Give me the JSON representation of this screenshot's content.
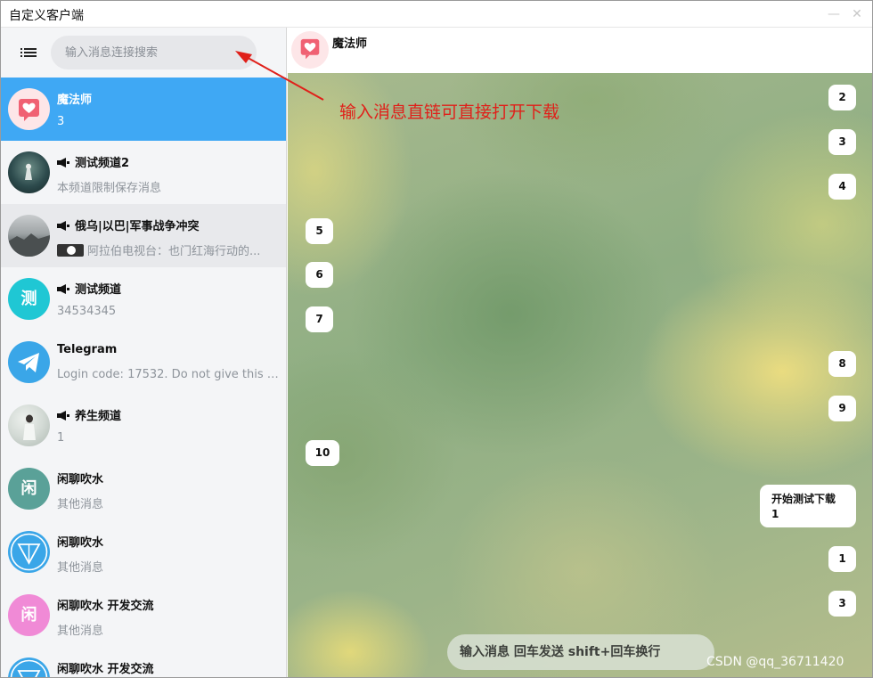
{
  "window": {
    "title": "自定义客户端",
    "minimize_icon": "minimize-icon",
    "close_icon": "close-icon"
  },
  "sidebar": {
    "menu_icon": "menu-list-icon",
    "search_placeholder": "输入消息连接搜索",
    "chats": [
      {
        "name": "魔法师",
        "preview": "3",
        "avatar": "heart-chat-avatar",
        "channel": false,
        "active": true
      },
      {
        "name": "测试频道2",
        "preview": "本频道限制保存消息",
        "avatar": "photo-avatar",
        "channel": true
      },
      {
        "name": "俄乌|以巴|军事战争冲突",
        "preview": "阿拉伯电视台：也门红海行动的...",
        "avatar": "photo-avatar",
        "channel": true,
        "preview_media": "video-thumbnail"
      },
      {
        "name": "测试频道",
        "preview": "34534345",
        "avatar_letter": "测",
        "avatar_color": "#1fc7d4",
        "channel": true
      },
      {
        "name": "Telegram",
        "preview": "Login code: 17532. Do not give this co...",
        "avatar": "telegram-logo",
        "avatar_color": "#3aa6e8",
        "channel": false
      },
      {
        "name": "养生频道",
        "preview": "1",
        "avatar": "photo-avatar",
        "channel": true
      },
      {
        "name": "闲聊吹水",
        "preview": "其他消息",
        "avatar_letter": "闲",
        "avatar_color": "#5aa198",
        "channel": false
      },
      {
        "name": "闲聊吹水",
        "preview": "其他消息",
        "avatar": "triangle-logo",
        "avatar_color": "#3aa6e8",
        "channel": false
      },
      {
        "name": "闲聊吹水 开发交流",
        "preview": "其他消息",
        "avatar_letter": "闲",
        "avatar_color": "#f08ad6",
        "channel": false
      },
      {
        "name": "闲聊吹水 开发交流",
        "preview": "",
        "avatar": "triangle-logo",
        "avatar_color": "#3aa6e8",
        "channel": false
      }
    ]
  },
  "chat": {
    "title": "魔法师",
    "avatar": "heart-chat-avatar",
    "messages": [
      {
        "text": "2",
        "side": "right"
      },
      {
        "text": "3",
        "side": "right"
      },
      {
        "text": "4",
        "side": "right"
      },
      {
        "text": "5",
        "side": "left"
      },
      {
        "text": "6",
        "side": "left"
      },
      {
        "text": "7",
        "side": "left"
      },
      {
        "text": "8",
        "side": "right"
      },
      {
        "text": "9",
        "side": "right"
      },
      {
        "text": "10",
        "side": "left"
      },
      {
        "text_line1": "开始测试下载",
        "text_line2": "1",
        "side": "right"
      },
      {
        "text": "1",
        "side": "right"
      },
      {
        "text": "3",
        "side": "right"
      }
    ],
    "composer_placeholder": "输入消息 回车发送 shift+回车换行"
  },
  "annotation": {
    "text": "输入消息直链可直接打开下载",
    "color": "#e0201a"
  },
  "watermark": "CSDN @qq_36711420",
  "colors": {
    "active_chat": "#3fa8f4",
    "sidebar_bg": "#f4f5f7"
  }
}
